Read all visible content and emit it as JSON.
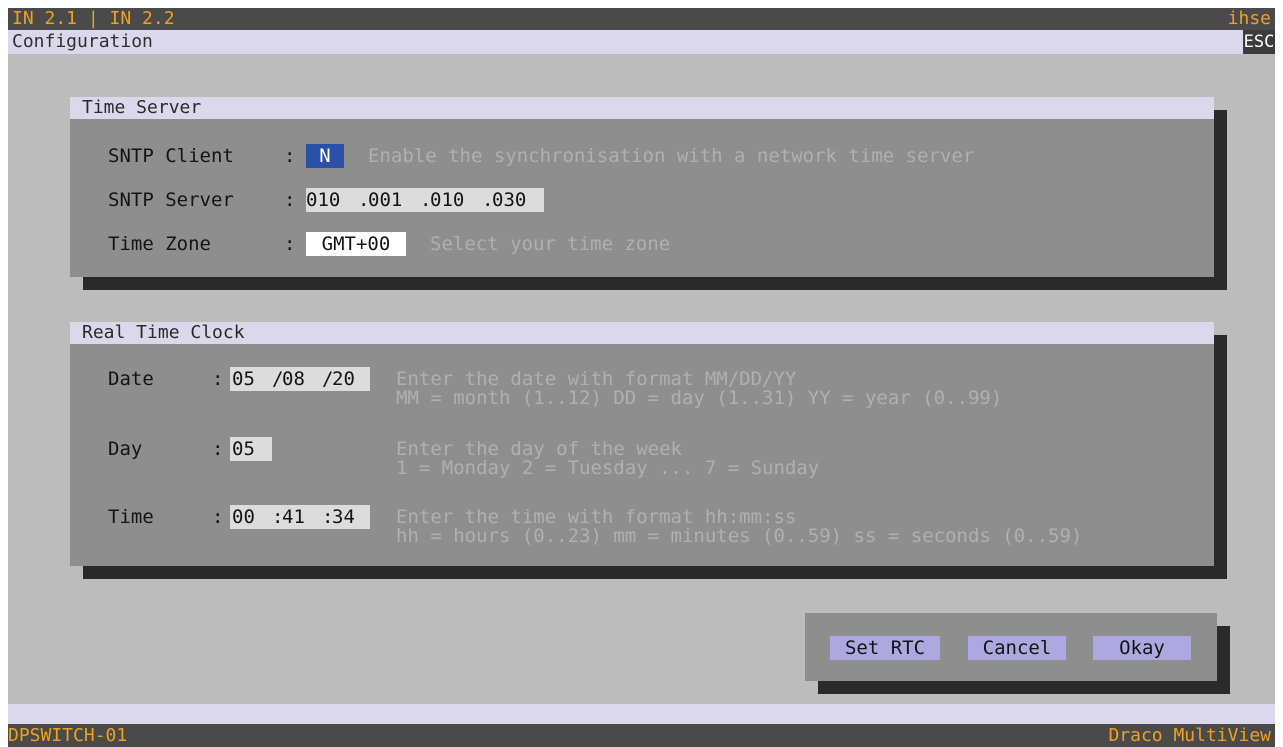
{
  "header": {
    "title": "IN 2.1 | IN 2.2",
    "brand": "ihse"
  },
  "subheader": {
    "title": "Configuration",
    "esc_label": "ESC"
  },
  "time_server": {
    "title": "Time Server",
    "sntp_client": {
      "label": "SNTP Client",
      "sep": ":",
      "value": "N",
      "hint": "Enable the synchronisation with a network time server"
    },
    "sntp_server": {
      "label": "SNTP Server",
      "sep": ":",
      "octets": [
        "010",
        "001",
        "010",
        "030"
      ]
    },
    "time_zone": {
      "label": "Time Zone",
      "sep": ":",
      "value": "GMT+00",
      "hint": "Select your time zone"
    }
  },
  "rtc": {
    "title": "Real Time Clock",
    "date": {
      "label": "Date",
      "sep": ":",
      "month": "05",
      "day": "08",
      "year": "20",
      "hint1": "Enter the date with format MM/DD/YY",
      "hint2": "MM = month (1..12) DD = day (1..31) YY = year (0..99)"
    },
    "day": {
      "label": "Day",
      "sep": ":",
      "value": "05",
      "hint1": "Enter the day of the week",
      "hint2": "1 = Monday 2 = Tuesday ... 7 = Sunday"
    },
    "time": {
      "label": "Time",
      "sep": ":",
      "hh": "00",
      "mm": "41",
      "ss": "34",
      "hint1": "Enter the time with format hh:mm:ss",
      "hint2": "hh = hours (0..23) mm = minutes (0..59) ss = seconds (0..59)"
    }
  },
  "buttons": {
    "set_rtc": "Set RTC",
    "cancel": "Cancel",
    "okay": "Okay"
  },
  "footer": {
    "device": "DPSWITCH-01",
    "product": "Draco MultiView"
  }
}
